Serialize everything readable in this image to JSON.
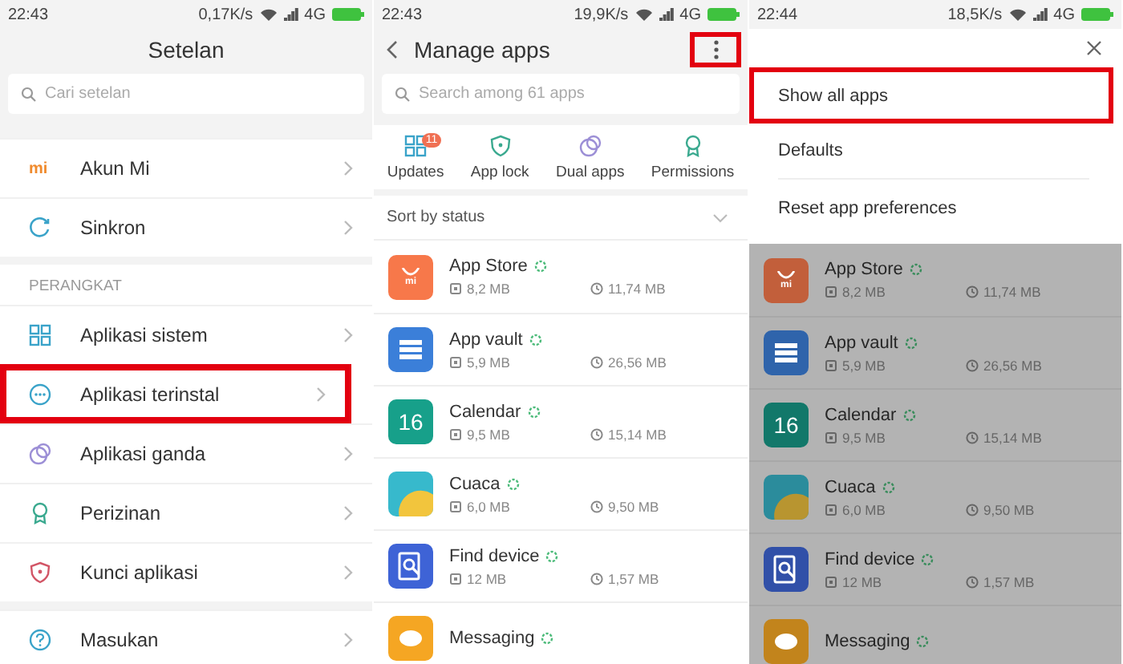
{
  "settings_screen": {
    "status_bar": {
      "time": "22:43",
      "speed": "0,17K/s",
      "network": "4G"
    },
    "title": "Setelan",
    "search": {
      "placeholder": "Cari setelan"
    },
    "groups": [
      {
        "items": [
          {
            "label": "Akun Mi",
            "kind": "logo",
            "icon_text": "mi",
            "highlighted": false
          },
          {
            "label": "Sinkron",
            "kind": "sync",
            "highlighted": false
          }
        ]
      },
      {
        "header": "PERANGKAT",
        "items": [
          {
            "label": "Aplikasi sistem",
            "kind": "grid",
            "highlighted": false
          },
          {
            "label": "Aplikasi terinstal",
            "kind": "dots",
            "highlighted": true
          },
          {
            "label": "Aplikasi ganda",
            "kind": "dual",
            "highlighted": false
          },
          {
            "label": "Perizinan",
            "kind": "award",
            "highlighted": false
          },
          {
            "label": "Kunci aplikasi",
            "kind": "shield",
            "highlighted": false
          }
        ]
      },
      {
        "items": [
          {
            "label": "Masukan",
            "kind": "help",
            "highlighted": false
          }
        ]
      }
    ]
  },
  "manage_apps_screen": {
    "status_bar": {
      "time": "22:43",
      "speed": "19,9K/s",
      "network": "4G"
    },
    "title": "Manage apps",
    "more_highlighted": true,
    "search": {
      "placeholder": "Search among 61 apps"
    },
    "shortcuts": [
      {
        "label": "Updates",
        "kind": "grid",
        "badge": "11"
      },
      {
        "label": "App lock",
        "kind": "shield"
      },
      {
        "label": "Dual apps",
        "kind": "dual"
      },
      {
        "label": "Permissions",
        "kind": "award"
      }
    ],
    "sort": {
      "label": "Sort by status"
    },
    "apps": [
      {
        "name": "App Store",
        "kind": "store",
        "color": "#f7784a",
        "icon_text": "mi",
        "storage": "8,2 MB",
        "cache": "11,74 MB"
      },
      {
        "name": "App vault",
        "kind": "vault",
        "color": "#3b7fd9",
        "storage": "5,9 MB",
        "cache": "26,56 MB"
      },
      {
        "name": "Calendar",
        "kind": "calendar",
        "color": "#17a08a",
        "icon_text": "16",
        "storage": "9,5 MB",
        "cache": "15,14 MB"
      },
      {
        "name": "Cuaca",
        "kind": "weather",
        "color": "#37b9cc",
        "storage": "6,0 MB",
        "cache": "9,50 MB"
      },
      {
        "name": "Find device",
        "kind": "find",
        "color": "#3e63d6",
        "storage": "12 MB",
        "cache": "1,57 MB"
      },
      {
        "name": "Messaging",
        "kind": "messaging",
        "color": "#f5a623"
      }
    ]
  },
  "menu_screen": {
    "status_bar": {
      "time": "22:44",
      "speed": "18,5K/s",
      "network": "4G"
    },
    "menu_items": [
      {
        "label": "Show all apps",
        "highlighted": true
      },
      {
        "label": "Defaults",
        "highlighted": false
      },
      {
        "label": "Reset app preferences",
        "highlighted": false
      }
    ],
    "dimmed": true,
    "apps": [
      {
        "name": "App Store",
        "kind": "store",
        "color": "#c25f3b",
        "icon_text": "mi",
        "storage": "8,2 MB",
        "cache": "11,74 MB"
      },
      {
        "name": "App vault",
        "kind": "vault",
        "color": "#2f64ab",
        "storage": "5,9 MB",
        "cache": "26,56 MB"
      },
      {
        "name": "Calendar",
        "kind": "calendar",
        "color": "#12786a",
        "icon_text": "16",
        "storage": "9,5 MB",
        "cache": "15,14 MB"
      },
      {
        "name": "Cuaca",
        "kind": "weather",
        "color": "#2b8c9c",
        "storage": "6,0 MB",
        "cache": "9,50 MB"
      },
      {
        "name": "Find device",
        "kind": "find",
        "color": "#3150a8",
        "storage": "12 MB",
        "cache": "1,57 MB"
      },
      {
        "name": "Messaging",
        "kind": "messaging",
        "color": "#c2841c"
      }
    ]
  }
}
